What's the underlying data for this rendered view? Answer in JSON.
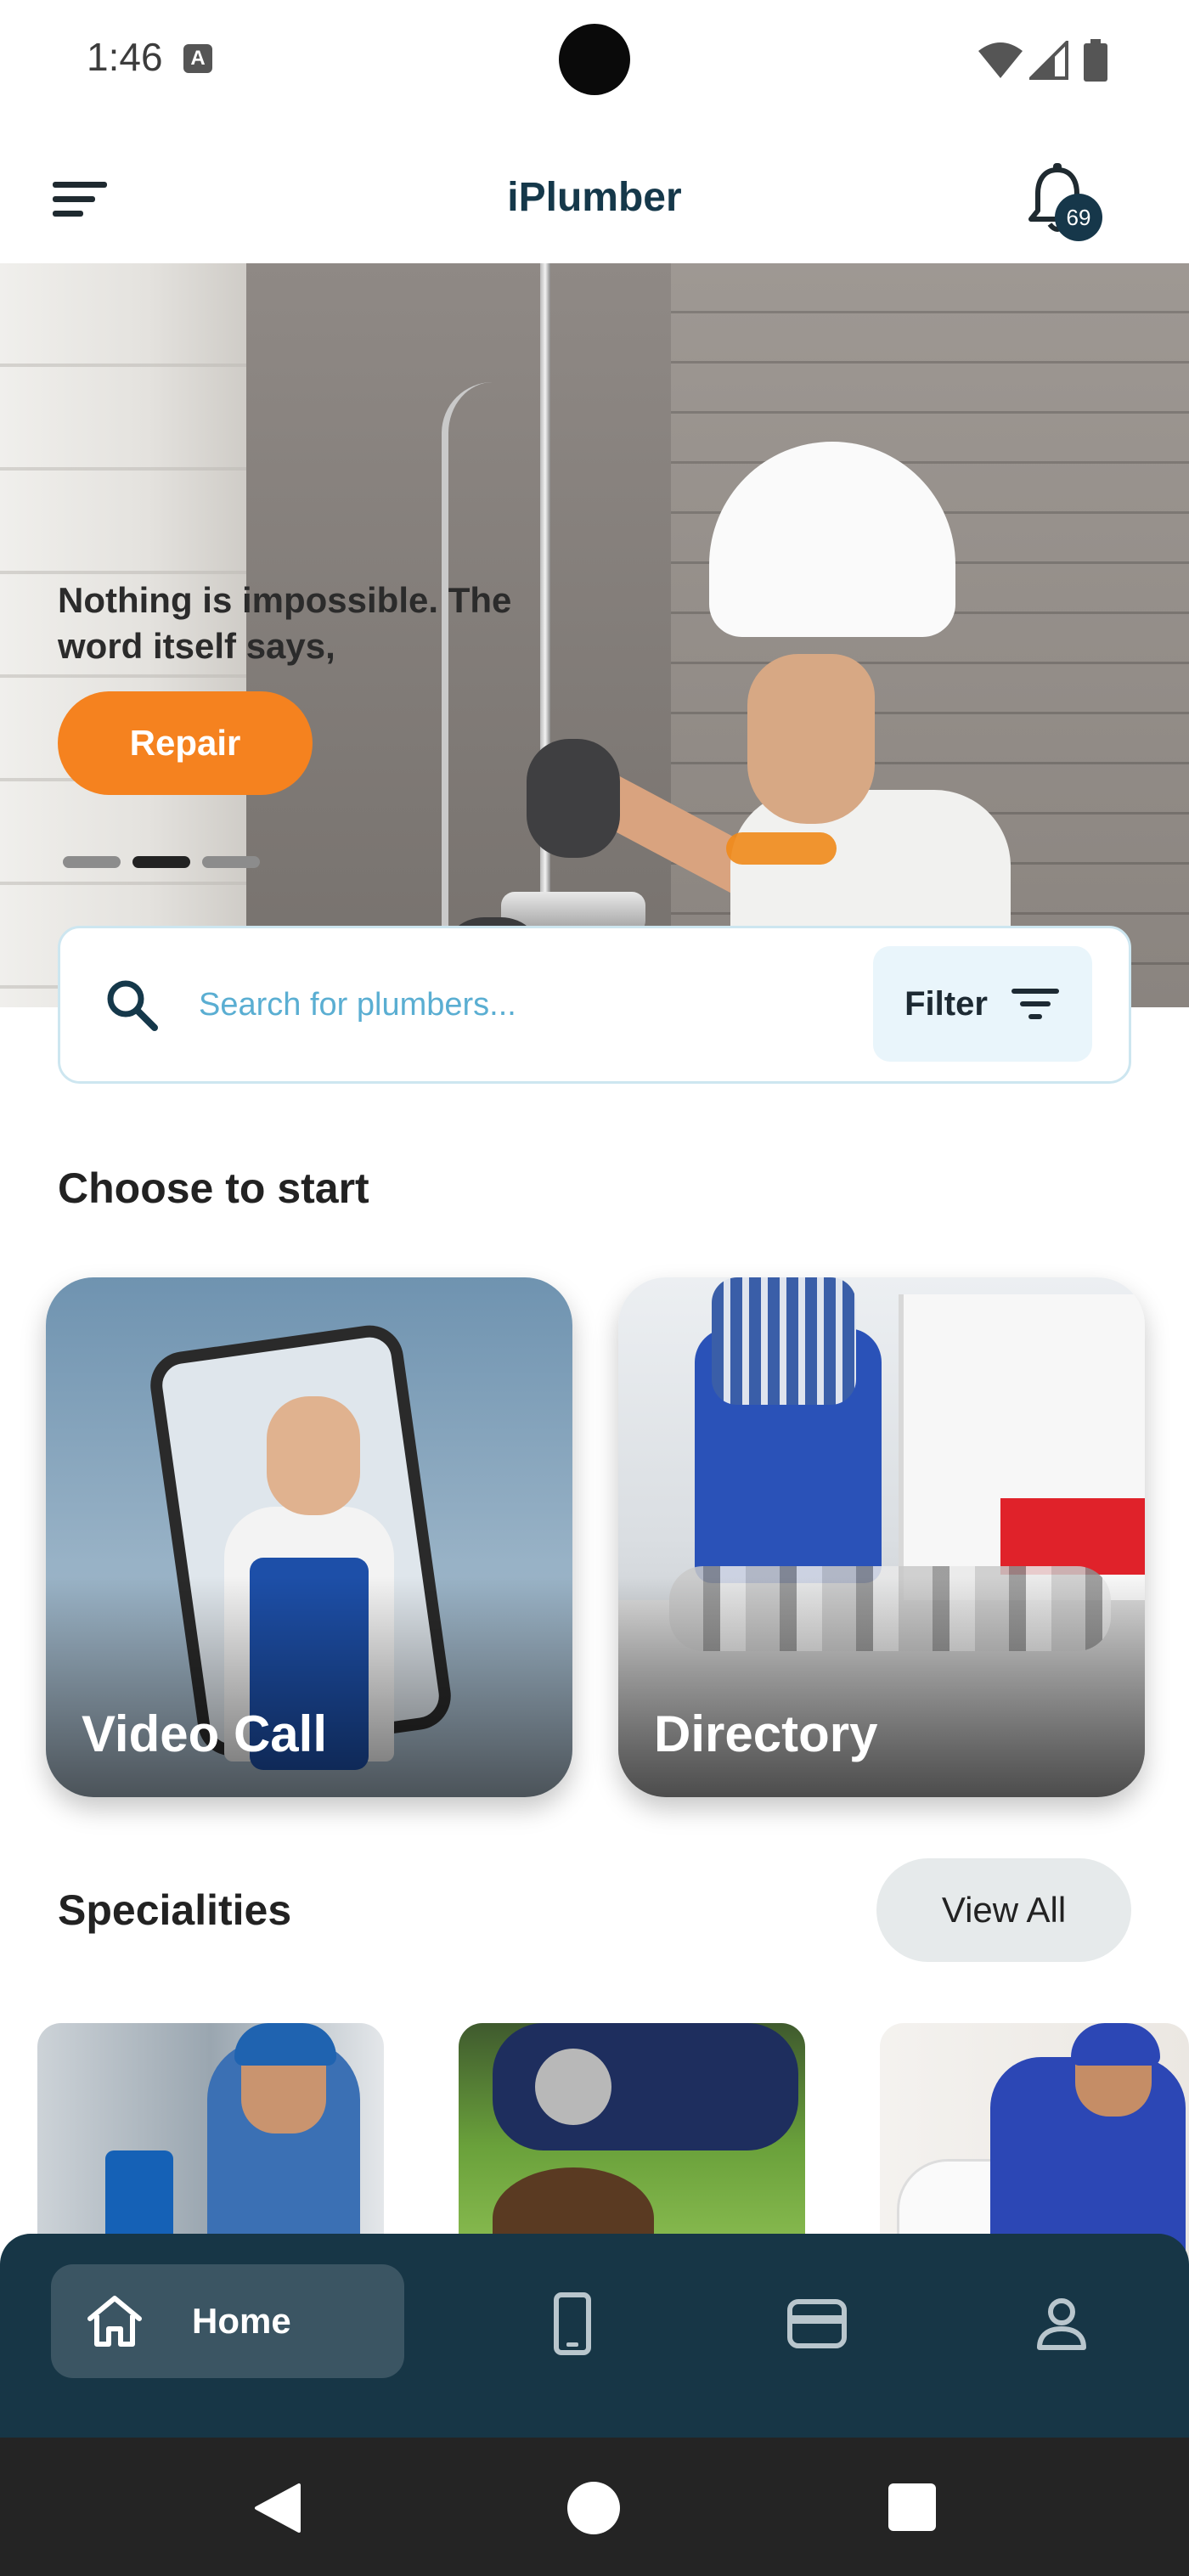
{
  "status_bar": {
    "time": "1:46",
    "badge": "A"
  },
  "app_bar": {
    "title": "iPlumber",
    "notification_count": "69"
  },
  "hero": {
    "headline": "Nothing is impossible. The word itself says,",
    "button_label": "Repair",
    "active_slide": 2,
    "slide_count": 3
  },
  "search": {
    "placeholder": "Search for plumbers...",
    "filter_label": "Filter"
  },
  "choose": {
    "title": "Choose to start",
    "cards": [
      {
        "label": "Video Call"
      },
      {
        "label": "Directory"
      }
    ]
  },
  "specialities": {
    "title": "Specialities",
    "view_all_label": "View All"
  },
  "bottom_nav": {
    "items": [
      {
        "label": "Home",
        "icon": "home-icon",
        "active": true
      },
      {
        "label": "",
        "icon": "phone-icon",
        "active": false
      },
      {
        "label": "",
        "icon": "wallet-icon",
        "active": false
      },
      {
        "label": "",
        "icon": "profile-icon",
        "active": false
      }
    ]
  },
  "colors": {
    "brand_dark": "#173646",
    "accent_orange": "#f5821f",
    "search_text": "#5aaed2"
  }
}
